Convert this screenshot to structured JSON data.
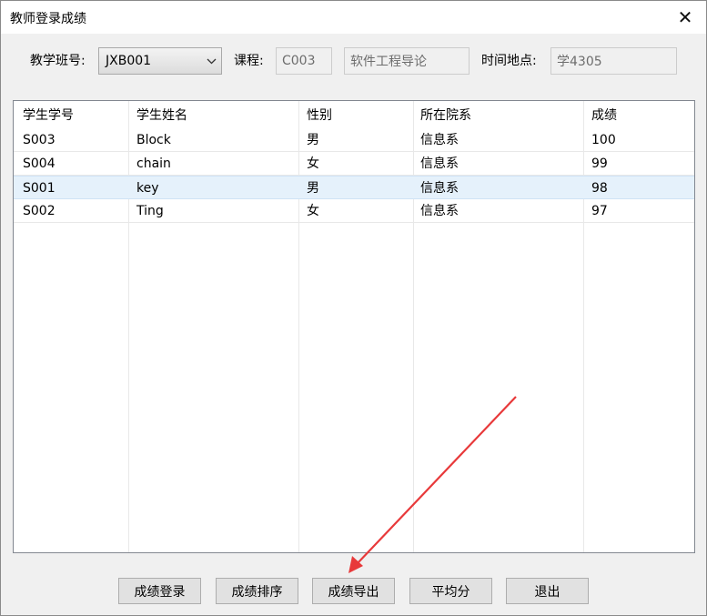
{
  "window": {
    "title": "教师登录成绩",
    "close_glyph": "✕"
  },
  "filters": {
    "class_label": "教学班号:",
    "class_value": "JXB001",
    "course_label": "课程:",
    "course_id": "C003",
    "course_name": "软件工程导论",
    "place_label": "时间地点:",
    "place_value": "学4305"
  },
  "table": {
    "headers": [
      "学生学号",
      "学生姓名",
      "性别",
      "所在院系",
      "成绩"
    ],
    "rows": [
      [
        "S003",
        "Block",
        "男",
        "信息系",
        "100"
      ],
      [
        "S004",
        "chain",
        "女",
        "信息系",
        "99"
      ],
      [
        "S001",
        "key",
        "男",
        "信息系",
        "98"
      ],
      [
        "S002",
        "Ting",
        "女",
        "信息系",
        "97"
      ]
    ],
    "selected_row": 2
  },
  "buttons": {
    "enter": "成绩登录",
    "sort": "成绩排序",
    "export": "成绩导出",
    "average": "平均分",
    "exit": "退出"
  },
  "colors": {
    "annotation_arrow": "#e8393a",
    "selection": "#e5f1fb"
  }
}
